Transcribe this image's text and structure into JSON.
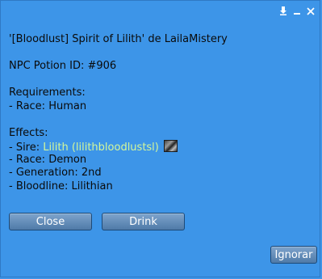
{
  "dialog": {
    "heading": "'[Bloodlust] Spirit of Lilith' de LailaMistery",
    "potion_id": "NPC Potion ID: #906",
    "requirements_title": "Requirements:",
    "requirements": [
      "- Race: Human"
    ],
    "effects_title": "Effects:",
    "sire_prefix": "- Sire: ",
    "sire_link": "Lilith (lilithbloodlustsl)",
    "effects": [
      "- Race: Demon",
      "- Generation: 2nd",
      "- Bloodline: Lilithian"
    ]
  },
  "buttons": {
    "close": "Close",
    "drink": "Drink",
    "ignore": "Ignorar"
  },
  "colors": {
    "background": "#3d95e8",
    "link": "#d4f79a"
  },
  "icons": [
    "pin-icon",
    "minimize-icon",
    "close-window-icon",
    "avatar-thumbnail"
  ]
}
